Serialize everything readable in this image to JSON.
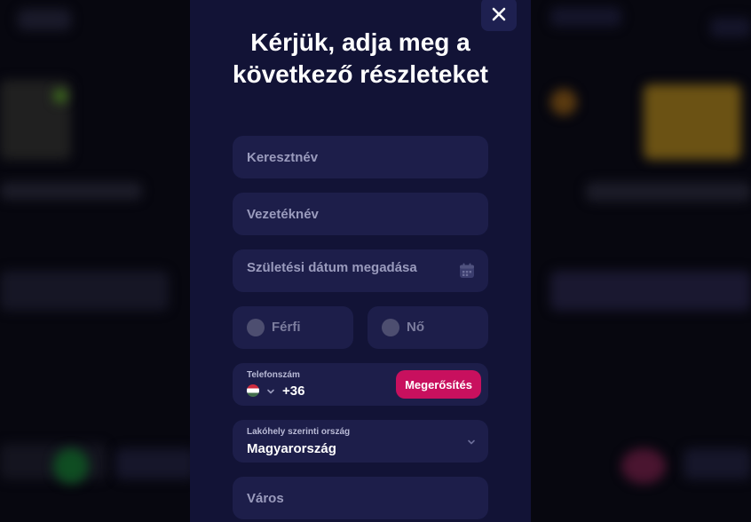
{
  "modal": {
    "title": "Kérjük, adja meg a következő részleteket"
  },
  "form": {
    "first_name_placeholder": "Keresztnév",
    "last_name_placeholder": "Vezetéknév",
    "birthdate_placeholder": "Születési dátum megadása",
    "gender_options": [
      "Férfi",
      "Nő"
    ],
    "phone": {
      "label": "Telefonszám",
      "country_code": "+36",
      "flag": "hungary-flag-icon",
      "confirm_label": "Megerősítés"
    },
    "country": {
      "label": "Lakóhely szerinti ország",
      "value": "Magyarország"
    },
    "city_placeholder": "Város"
  },
  "colors": {
    "modal_bg": "#121336",
    "field_bg": "#1d1e4a",
    "accent": "#c8105e",
    "page_bg": "#07070f"
  },
  "icons": {
    "close": "close-icon",
    "calendar": "calendar-icon",
    "dropdown": "chevron-down-icon"
  }
}
